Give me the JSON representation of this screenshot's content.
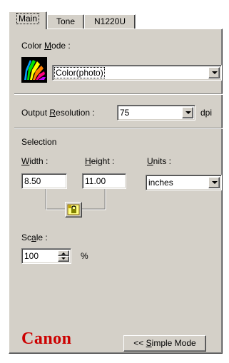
{
  "tabs": [
    {
      "label": "Main",
      "active": true
    },
    {
      "label": "Tone",
      "active": false
    },
    {
      "label": "N1220U",
      "active": false
    }
  ],
  "color_mode": {
    "label_pre": "Color ",
    "label_key": "M",
    "label_post": "ode :",
    "value": "Color(photo)"
  },
  "output_resolution": {
    "label_pre": "Output ",
    "label_key": "R",
    "label_post": "esolution :",
    "value": "75",
    "unit": "dpi"
  },
  "selection": {
    "heading": "Selection",
    "width_label_key": "W",
    "width_label_post": "idth :",
    "height_label_key": "H",
    "height_label_post": "eight :",
    "units_label_key": "U",
    "units_label_post": "nits :",
    "width_value": "8.50",
    "height_value": "11.00",
    "units_value": "inches"
  },
  "scale": {
    "label_pre": "Sc",
    "label_key": "a",
    "label_post": "le :",
    "value": "100",
    "unit": "%"
  },
  "brand": {
    "logo_text": "Canon",
    "color": "#cc0000"
  },
  "simple_mode_button": {
    "pre": "<< ",
    "key": "S",
    "post": "imple Mode"
  }
}
